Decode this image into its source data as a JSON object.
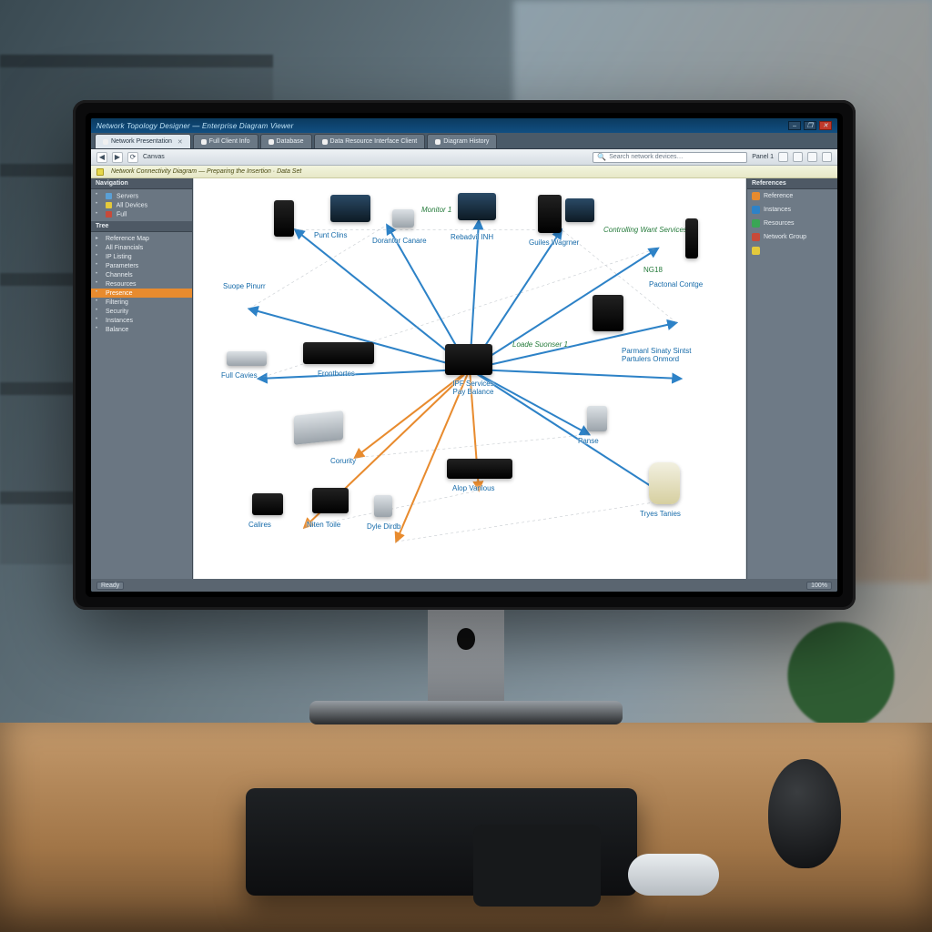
{
  "window": {
    "title": "Network Topology Designer — Enterprise Diagram Viewer",
    "buttons": {
      "min": "–",
      "max": "❐",
      "close": "✕"
    }
  },
  "tabs": [
    {
      "label": "Network Presentation",
      "active": true
    },
    {
      "label": "Full Client Info",
      "active": false
    },
    {
      "label": "Database",
      "active": false
    },
    {
      "label": "Data Resource Interface Client",
      "active": false
    },
    {
      "label": "Diagram History",
      "active": false
    }
  ],
  "toolbar": {
    "nav_label": "Canvas",
    "search_placeholder": "Search network devices…",
    "right_label": "Panel 1"
  },
  "docbar": {
    "line1": "Network Connectivity Diagram — Preparing the Insertion · Data Set",
    "line2": ""
  },
  "sidebar": {
    "title": "Navigation",
    "groups": [
      {
        "label": "Servers",
        "color": "#5aa0d6"
      },
      {
        "label": "All Devices",
        "color": "#e4c93b"
      },
      {
        "label": "Full",
        "color": "#c74a3a"
      }
    ],
    "tree": [
      {
        "label": "Reference Map",
        "leaf": false
      },
      {
        "label": "All Financials",
        "leaf": true
      },
      {
        "label": "IP Listing",
        "leaf": true
      },
      {
        "label": "Parameters",
        "leaf": true
      },
      {
        "label": "Channels",
        "leaf": true
      },
      {
        "label": "Resources",
        "leaf": true
      },
      {
        "label": "Presence",
        "leaf": true,
        "highlight": true
      },
      {
        "label": "Filtering",
        "leaf": true
      },
      {
        "label": "Security",
        "leaf": true
      },
      {
        "label": "Instances",
        "leaf": true
      },
      {
        "label": "Balance",
        "leaf": true
      }
    ]
  },
  "rightpanel": {
    "title": "References",
    "items": [
      {
        "label": "Reference",
        "color": "or"
      },
      {
        "label": "Instances",
        "color": "bl"
      },
      {
        "label": "Resources",
        "color": "gr"
      },
      {
        "label": "Network Group",
        "color": "rd"
      },
      {
        "label": "",
        "color": "yl"
      }
    ]
  },
  "diagram": {
    "center_label": "IPF Services\nPay Balance",
    "nodes": {
      "top": [
        {
          "id": "n1",
          "label": "Punt Clins"
        },
        {
          "id": "n2",
          "label": "Dorantor Canare"
        },
        {
          "id": "n3",
          "label": "Rebadvil INH"
        },
        {
          "id": "n4",
          "label": "Guiles Wagrner"
        }
      ],
      "annotations_top": [
        {
          "id": "a1",
          "label": "Monitor 1"
        },
        {
          "id": "a2",
          "label": "Controlling Want Services"
        }
      ],
      "left": [
        {
          "id": "l1",
          "label": "Suope Pinurr"
        },
        {
          "id": "l2",
          "label": "Full Cavies"
        },
        {
          "id": "l3",
          "label": "Corurity"
        },
        {
          "id": "l4",
          "label": "Calires"
        },
        {
          "id": "l5",
          "label": "Niten Toile"
        }
      ],
      "right": [
        {
          "id": "r1",
          "label": "Pactonal Contge"
        },
        {
          "id": "r2",
          "label": "Parmanl Sinaty Sintst Partulers Onmord"
        },
        {
          "id": "r3",
          "label": "Panse"
        },
        {
          "id": "r4",
          "label": "Tryes Tanies"
        }
      ],
      "annotations_right": [
        {
          "id": "ar1",
          "label": "Loade Suonser 1"
        },
        {
          "id": "ar2",
          "label": "NG18"
        }
      ],
      "mid": [
        {
          "id": "m1",
          "label": "Frontbortes"
        }
      ],
      "bottom": [
        {
          "id": "b1",
          "label": "Dyle Dirdb"
        },
        {
          "id": "b2",
          "label": "Alop Vanlous"
        }
      ]
    }
  },
  "statusbar": {
    "left": "Ready",
    "zoom": "100%"
  }
}
